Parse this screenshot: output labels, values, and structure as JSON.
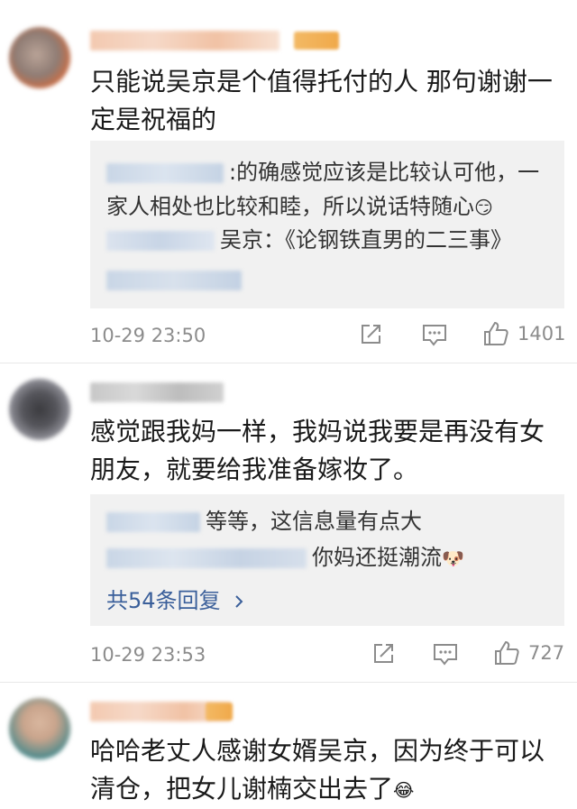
{
  "comments": [
    {
      "text": "只能说吴京是个值得托付的人 那句谢谢一定是祝福的",
      "replies": [
        {
          "text": ":的确感觉应该是比较认可他，一家人相处也比较和睦，所以说话特随心"
        },
        {
          "text": "吴京：《论钢铁直男的二三事》"
        }
      ],
      "time": "10-29 23:50",
      "likes": "1401"
    },
    {
      "text": "感觉跟我妈一样，我妈说我要是再没有女朋友，就要给我准备嫁妆了。",
      "replies": [
        {
          "text": "等等，这信息量有点大"
        },
        {
          "text": "你妈还挺潮流"
        }
      ],
      "more_replies": "共54条回复",
      "time": "10-29 23:53",
      "likes": "727"
    },
    {
      "text": "哈哈老丈人感谢女婿吴京，因为终于可以清仓，把女儿谢楠交出去了"
    }
  ],
  "icons": {
    "repost": "repost-icon",
    "comment": "comment-icon",
    "like": "like-icon",
    "chevron": "chevron-right-icon",
    "emoji_grin": "grin-emoji",
    "emoji_doge": "doge-emoji",
    "emoji_laugh_cry": "laugh-cry-emoji"
  },
  "colors": {
    "reply_bg": "#f1f1f1",
    "link": "#3a5f9a",
    "meta": "#8c8c8c"
  }
}
